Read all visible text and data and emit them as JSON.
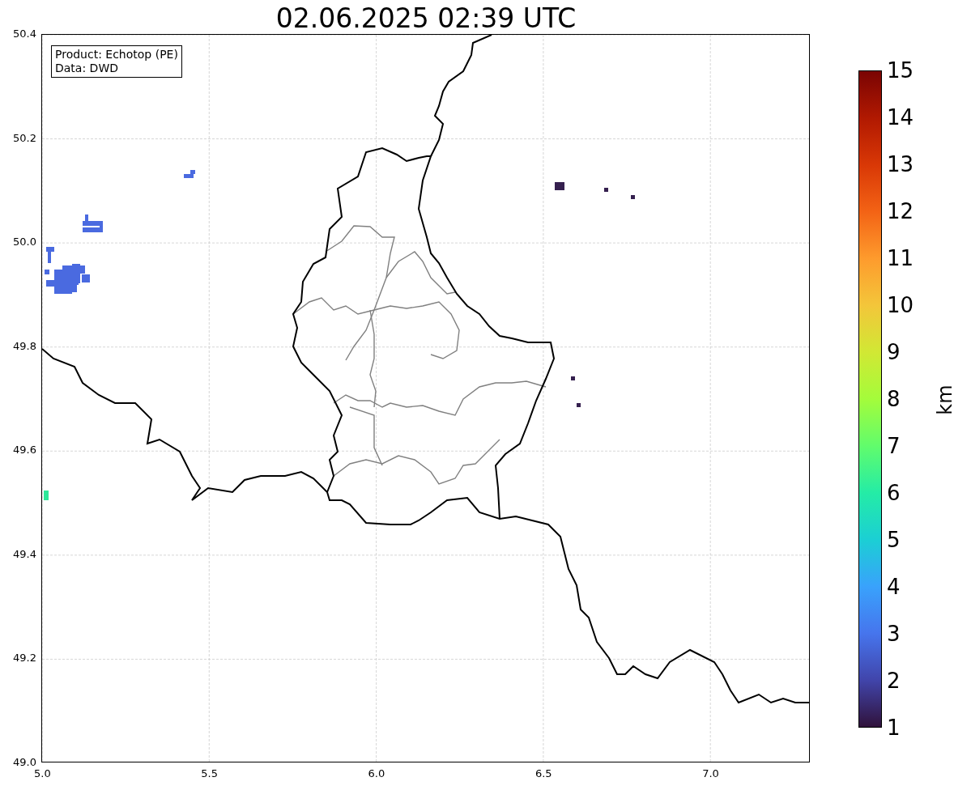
{
  "title": "02.06.2025 02:39 UTC",
  "info_box": [
    "Product: Echotop (PE)",
    "Data: DWD"
  ],
  "y_ticks": [
    "50.4",
    "50.2",
    "50.0",
    "49.8",
    "49.6",
    "49.4",
    "49.2",
    "49.0"
  ],
  "x_ticks": [
    "5.0",
    "5.5",
    "6.0",
    "6.5",
    "7.0"
  ],
  "colorbar": {
    "label": "km",
    "ticks": [
      "15",
      "14",
      "13",
      "12",
      "11",
      "10",
      "9",
      "8",
      "7",
      "6",
      "5",
      "4",
      "3",
      "2",
      "1"
    ]
  }
}
